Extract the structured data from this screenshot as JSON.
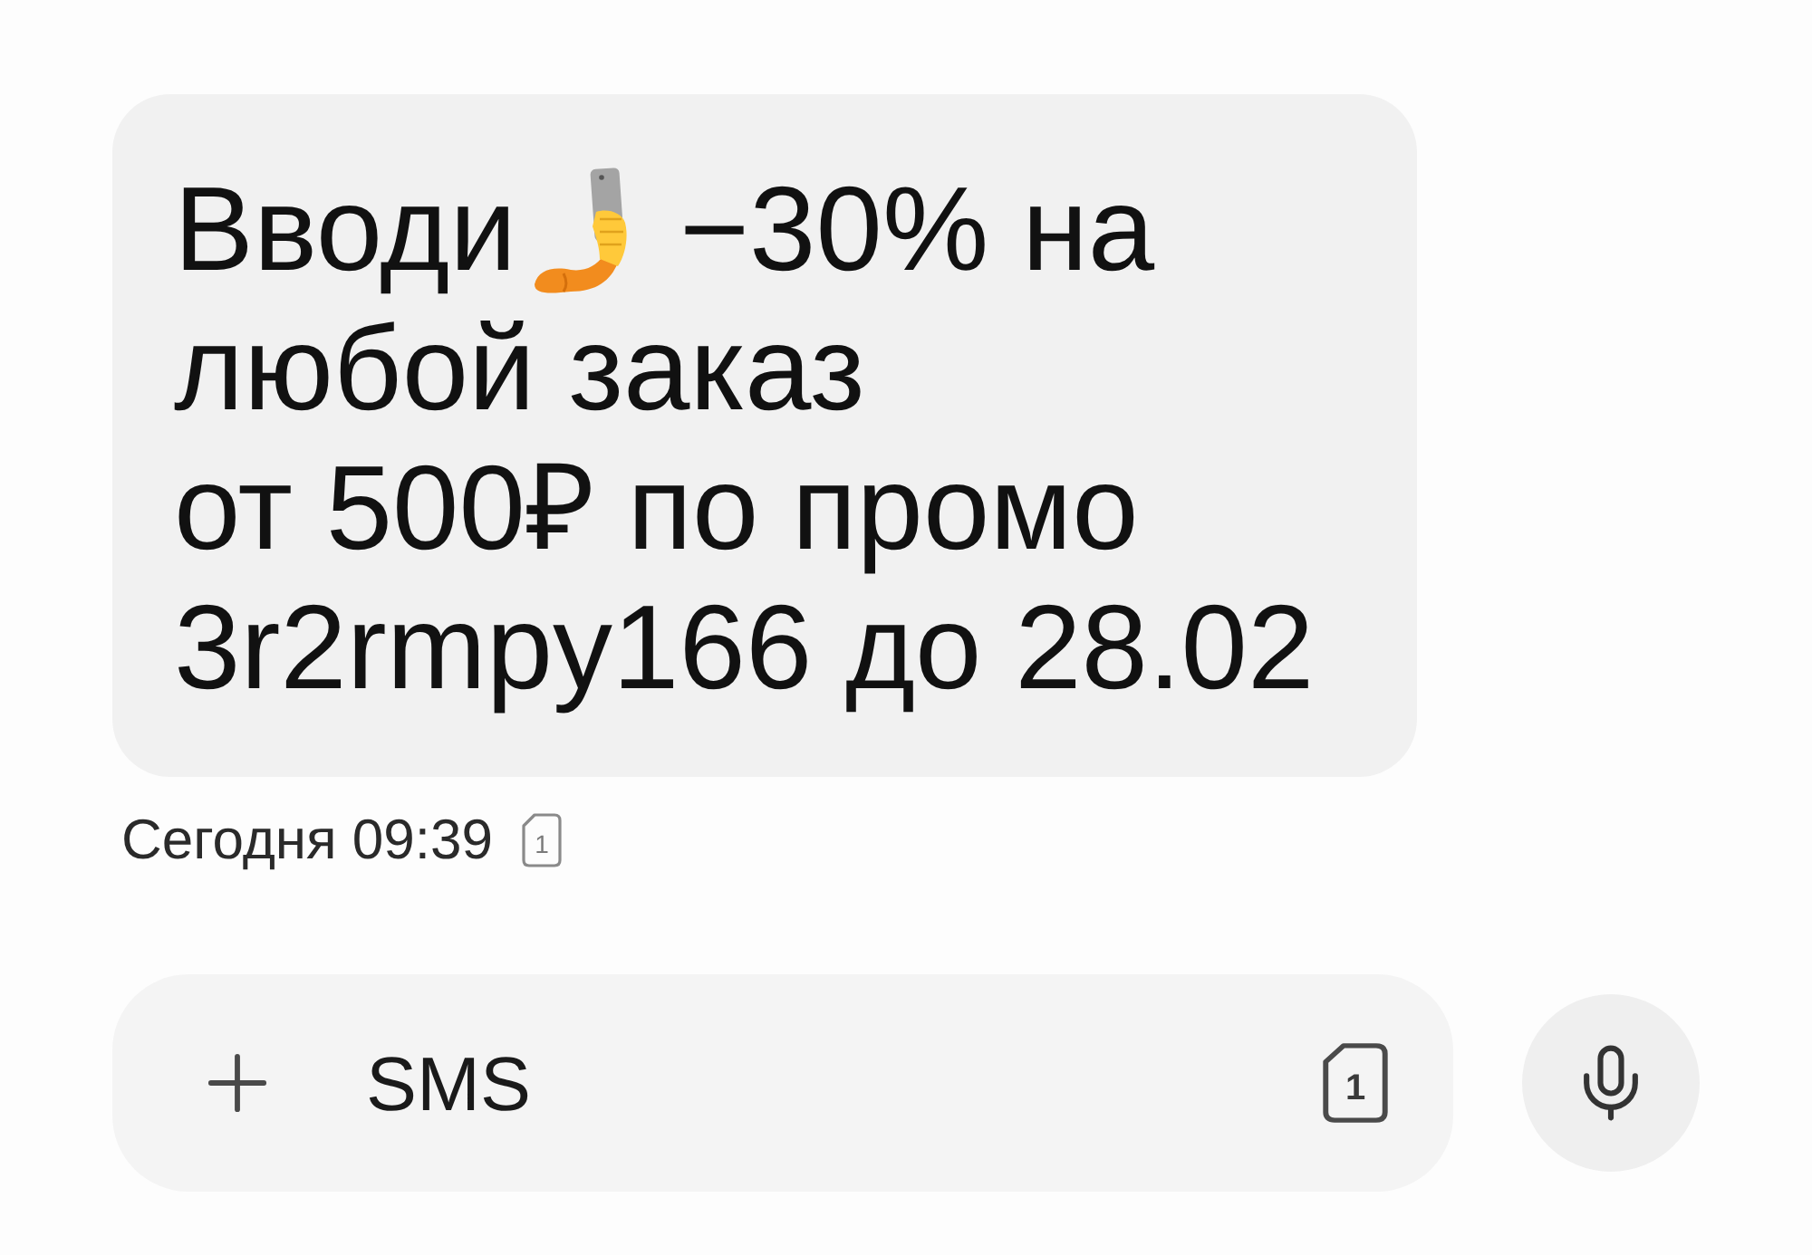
{
  "message": {
    "text_before_icon": "Вводи",
    "text_after_icon": "−30% на",
    "text_continued": "любой заказ\nот 500₽ по промо\n3r2rmpy166 до 28.02",
    "time": "Сегодня 09:39",
    "sim": "1"
  },
  "composer": {
    "placeholder": "SMS",
    "sim": "1"
  }
}
